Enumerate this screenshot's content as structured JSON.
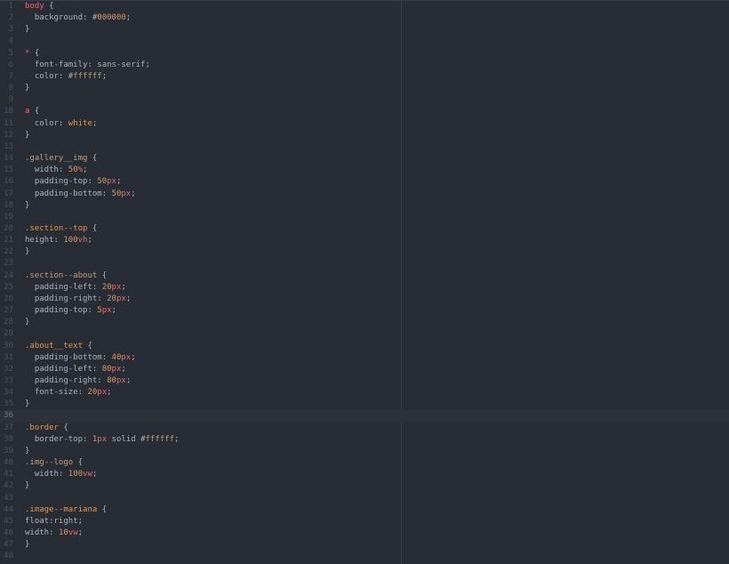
{
  "editor": {
    "language": "css",
    "current_line": 36,
    "lines": [
      {
        "n": "1",
        "tokens": [
          [
            "sel",
            "body"
          ],
          [
            "punc",
            " {"
          ]
        ]
      },
      {
        "n": "2",
        "tokens": [
          [
            "prop",
            "  background: "
          ],
          [
            "hash",
            "#"
          ],
          [
            "hex",
            "000000"
          ],
          [
            "punc",
            ";"
          ]
        ]
      },
      {
        "n": "3",
        "tokens": [
          [
            "punc",
            "}"
          ]
        ]
      },
      {
        "n": "4",
        "tokens": []
      },
      {
        "n": "5",
        "tokens": [
          [
            "sel",
            "*"
          ],
          [
            "punc",
            " {"
          ]
        ]
      },
      {
        "n": "6",
        "tokens": [
          [
            "prop",
            "  font-family: "
          ],
          [
            "val",
            "sans-serif"
          ],
          [
            "punc",
            ";"
          ]
        ]
      },
      {
        "n": "7",
        "tokens": [
          [
            "prop",
            "  color: "
          ],
          [
            "hash",
            "#"
          ],
          [
            "hex",
            "ffffff"
          ],
          [
            "punc",
            ";"
          ]
        ]
      },
      {
        "n": "8",
        "tokens": [
          [
            "punc",
            "}"
          ]
        ]
      },
      {
        "n": "9",
        "tokens": []
      },
      {
        "n": "10",
        "tokens": [
          [
            "sel",
            "a"
          ],
          [
            "punc",
            " {"
          ]
        ]
      },
      {
        "n": "11",
        "tokens": [
          [
            "prop",
            "  color: "
          ],
          [
            "kw",
            "white"
          ],
          [
            "punc",
            ";"
          ]
        ]
      },
      {
        "n": "12",
        "tokens": [
          [
            "punc",
            "}"
          ]
        ]
      },
      {
        "n": "13",
        "tokens": []
      },
      {
        "n": "14",
        "tokens": [
          [
            "cls",
            ".gallery__img"
          ],
          [
            "punc",
            " {"
          ]
        ]
      },
      {
        "n": "15",
        "tokens": [
          [
            "prop",
            "  width: "
          ],
          [
            "num",
            "50"
          ],
          [
            "unit",
            "%"
          ],
          [
            "punc",
            ";"
          ]
        ]
      },
      {
        "n": "16",
        "tokens": [
          [
            "prop",
            "  padding-top: "
          ],
          [
            "num",
            "50"
          ],
          [
            "unit",
            "px"
          ],
          [
            "punc",
            ";"
          ]
        ]
      },
      {
        "n": "17",
        "tokens": [
          [
            "prop",
            "  padding-bottom: "
          ],
          [
            "num",
            "50"
          ],
          [
            "unit",
            "px"
          ],
          [
            "punc",
            ";"
          ]
        ]
      },
      {
        "n": "18",
        "tokens": [
          [
            "punc",
            "}"
          ]
        ]
      },
      {
        "n": "19",
        "tokens": []
      },
      {
        "n": "20",
        "tokens": [
          [
            "cls",
            ".section--top"
          ],
          [
            "punc",
            " {"
          ]
        ]
      },
      {
        "n": "21",
        "tokens": [
          [
            "prop",
            "height: "
          ],
          [
            "num",
            "100"
          ],
          [
            "unit",
            "vh"
          ],
          [
            "punc",
            ";"
          ]
        ]
      },
      {
        "n": "22",
        "tokens": [
          [
            "punc",
            "}"
          ]
        ]
      },
      {
        "n": "23",
        "tokens": []
      },
      {
        "n": "24",
        "tokens": [
          [
            "cls",
            ".section--about"
          ],
          [
            "punc",
            " {"
          ]
        ]
      },
      {
        "n": "25",
        "tokens": [
          [
            "prop",
            "  padding-left: "
          ],
          [
            "num",
            "20"
          ],
          [
            "unit",
            "px"
          ],
          [
            "punc",
            ";"
          ]
        ]
      },
      {
        "n": "26",
        "tokens": [
          [
            "prop",
            "  padding-right: "
          ],
          [
            "num",
            "20"
          ],
          [
            "unit",
            "px"
          ],
          [
            "punc",
            ";"
          ]
        ]
      },
      {
        "n": "27",
        "tokens": [
          [
            "prop",
            "  padding-top: "
          ],
          [
            "num",
            "5"
          ],
          [
            "unit",
            "px"
          ],
          [
            "punc",
            ";"
          ]
        ]
      },
      {
        "n": "28",
        "tokens": [
          [
            "punc",
            "}"
          ]
        ]
      },
      {
        "n": "29",
        "tokens": []
      },
      {
        "n": "30",
        "tokens": [
          [
            "cls",
            ".about__text"
          ],
          [
            "punc",
            " {"
          ]
        ]
      },
      {
        "n": "31",
        "tokens": [
          [
            "prop",
            "  padding-bottom: "
          ],
          [
            "num",
            "40"
          ],
          [
            "unit",
            "px"
          ],
          [
            "punc",
            ";"
          ]
        ]
      },
      {
        "n": "32",
        "tokens": [
          [
            "prop",
            "  padding-left: "
          ],
          [
            "num",
            "80"
          ],
          [
            "unit",
            "px"
          ],
          [
            "punc",
            ";"
          ]
        ]
      },
      {
        "n": "33",
        "tokens": [
          [
            "prop",
            "  padding-right: "
          ],
          [
            "num",
            "80"
          ],
          [
            "unit",
            "px"
          ],
          [
            "punc",
            ";"
          ]
        ]
      },
      {
        "n": "34",
        "tokens": [
          [
            "prop",
            "  font-size: "
          ],
          [
            "num",
            "20"
          ],
          [
            "unit",
            "px"
          ],
          [
            "punc",
            ";"
          ]
        ]
      },
      {
        "n": "35",
        "tokens": [
          [
            "punc",
            "}"
          ]
        ]
      },
      {
        "n": "36",
        "tokens": []
      },
      {
        "n": "37",
        "tokens": [
          [
            "cls",
            ".border"
          ],
          [
            "punc",
            " {"
          ]
        ]
      },
      {
        "n": "38",
        "tokens": [
          [
            "prop",
            "  border-top: "
          ],
          [
            "num",
            "1"
          ],
          [
            "unit",
            "px"
          ],
          [
            "val",
            " solid "
          ],
          [
            "hash",
            "#"
          ],
          [
            "hex",
            "ffffff"
          ],
          [
            "punc",
            ";"
          ]
        ]
      },
      {
        "n": "39",
        "tokens": [
          [
            "punc",
            "}"
          ]
        ]
      },
      {
        "n": "40",
        "tokens": [
          [
            "cls",
            ".img--logo"
          ],
          [
            "punc",
            " {"
          ]
        ]
      },
      {
        "n": "41",
        "tokens": [
          [
            "prop",
            "  width: "
          ],
          [
            "num",
            "100"
          ],
          [
            "unit",
            "vw"
          ],
          [
            "punc",
            ";"
          ]
        ]
      },
      {
        "n": "42",
        "tokens": [
          [
            "punc",
            "}"
          ]
        ]
      },
      {
        "n": "43",
        "tokens": []
      },
      {
        "n": "44",
        "tokens": [
          [
            "cls",
            ".image--mariana"
          ],
          [
            "punc",
            " {"
          ]
        ]
      },
      {
        "n": "45",
        "tokens": [
          [
            "prop",
            "float:"
          ],
          [
            "val",
            "right"
          ],
          [
            "punc",
            ";"
          ]
        ]
      },
      {
        "n": "46",
        "tokens": [
          [
            "prop",
            "width: "
          ],
          [
            "num",
            "10"
          ],
          [
            "unit",
            "vw"
          ],
          [
            "punc",
            ";"
          ]
        ]
      },
      {
        "n": "47",
        "tokens": [
          [
            "punc",
            "}"
          ]
        ]
      },
      {
        "n": "48",
        "tokens": []
      }
    ]
  }
}
